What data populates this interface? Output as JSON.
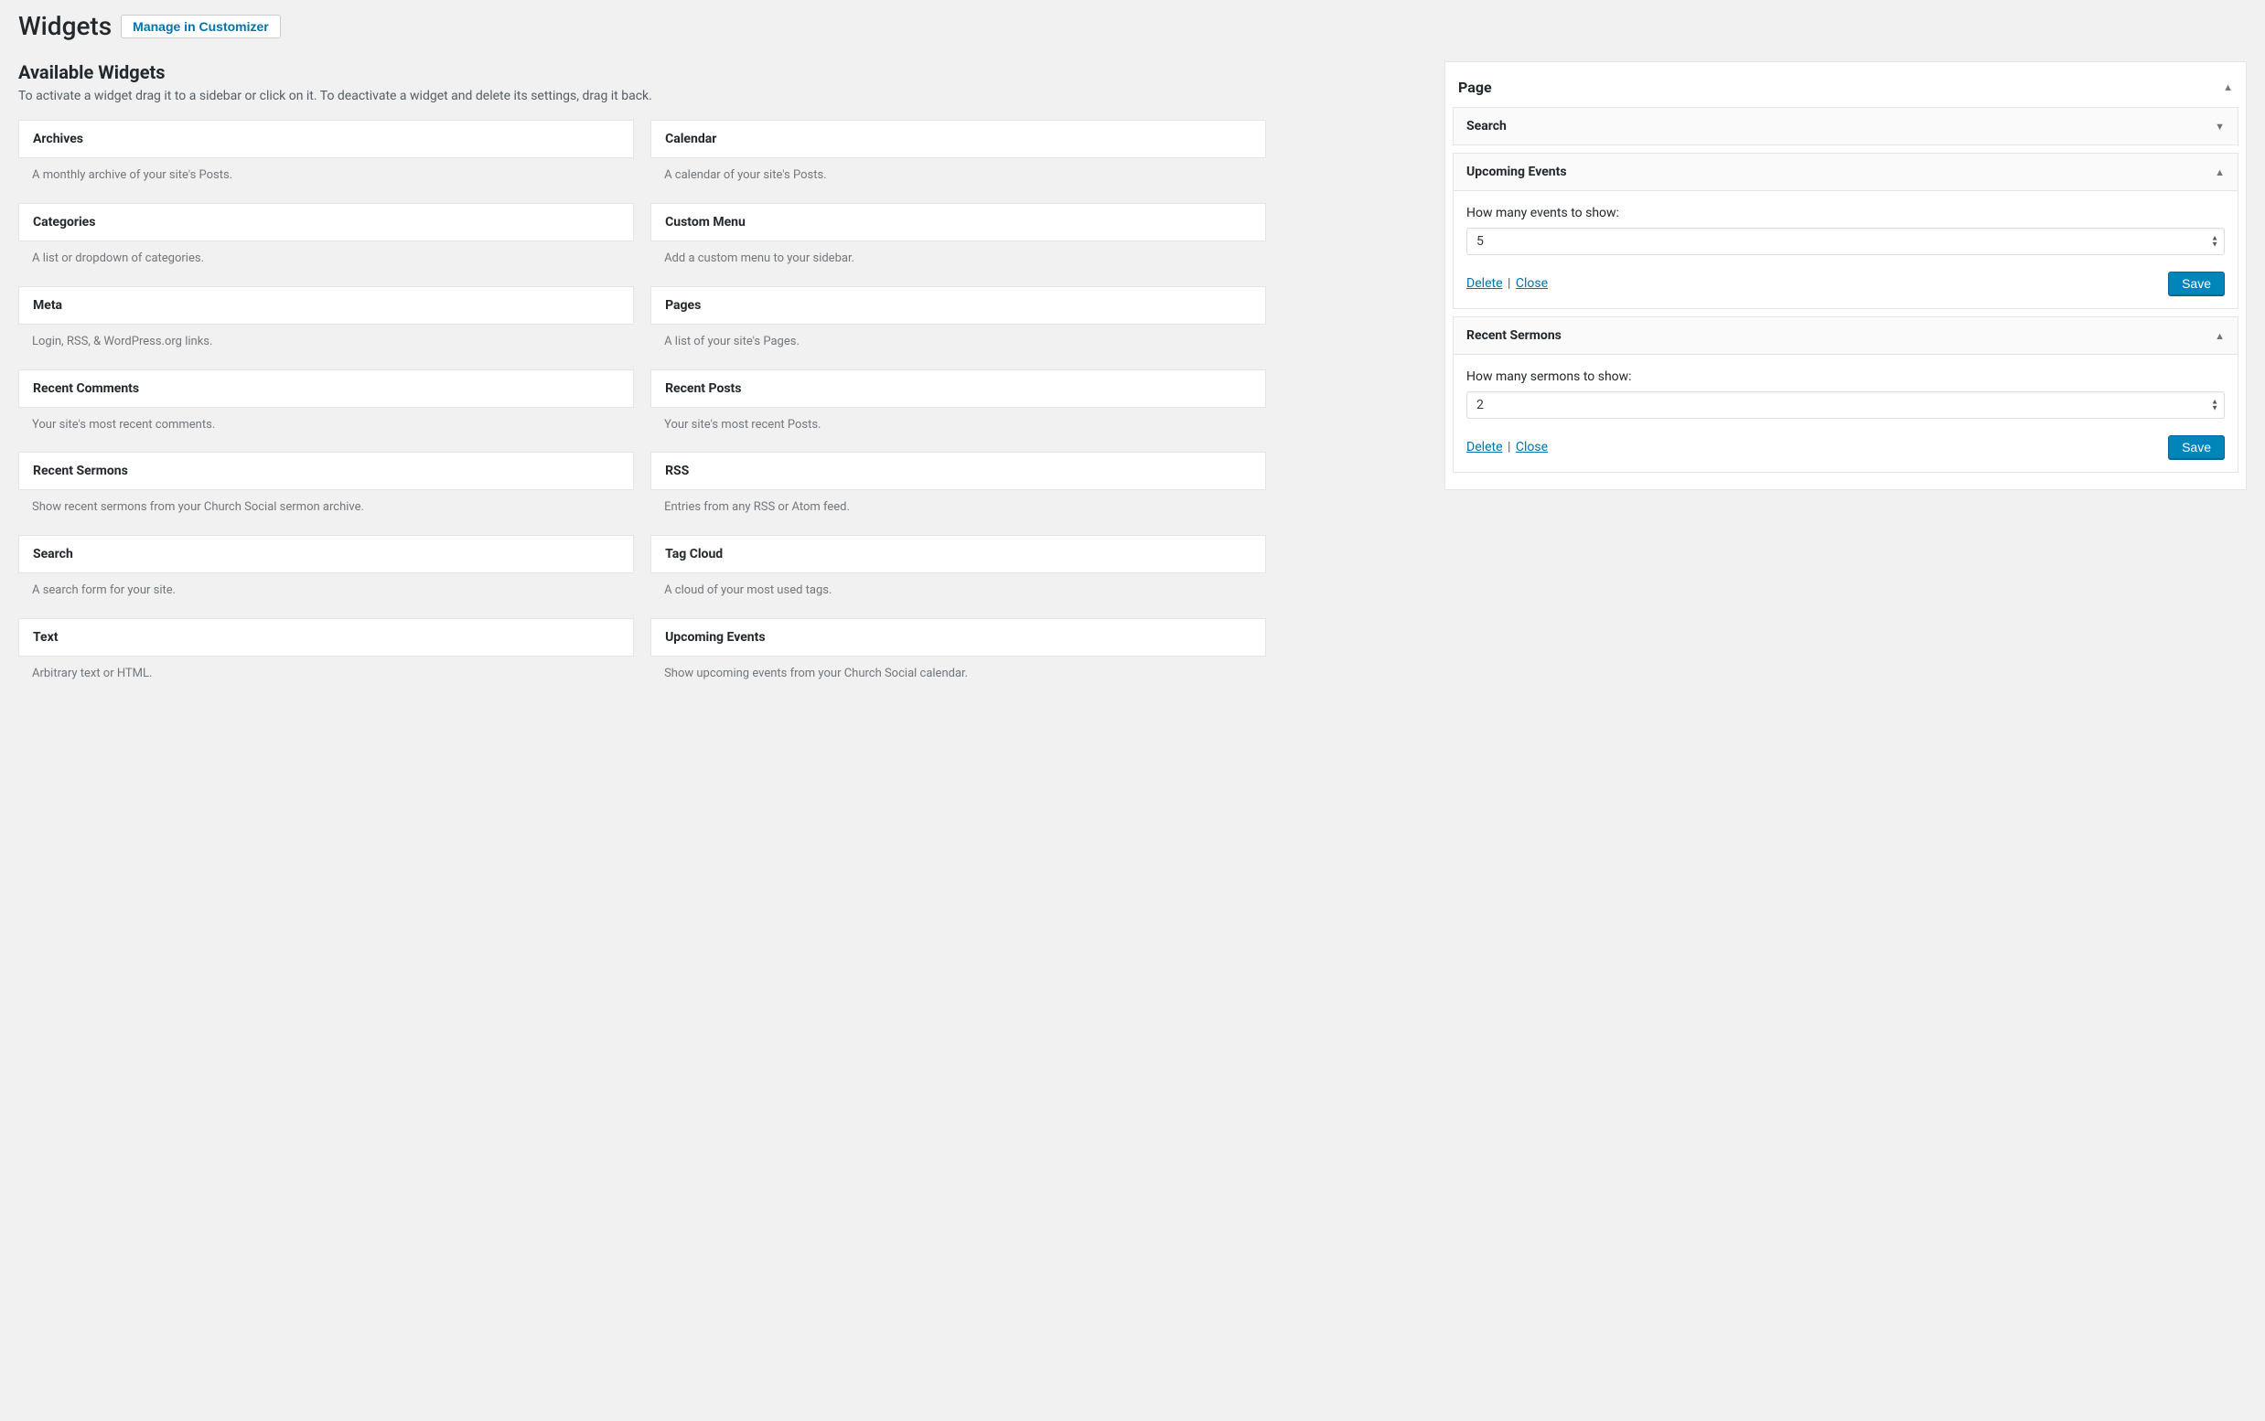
{
  "header": {
    "title": "Widgets",
    "customizer_button": "Manage in Customizer"
  },
  "available": {
    "title": "Available Widgets",
    "description": "To activate a widget drag it to a sidebar or click on it. To deactivate a widget and delete its settings, drag it back.",
    "items": [
      {
        "title": "Archives",
        "desc": "A monthly archive of your site's Posts."
      },
      {
        "title": "Calendar",
        "desc": "A calendar of your site's Posts."
      },
      {
        "title": "Categories",
        "desc": "A list or dropdown of categories."
      },
      {
        "title": "Custom Menu",
        "desc": "Add a custom menu to your sidebar."
      },
      {
        "title": "Meta",
        "desc": "Login, RSS, & WordPress.org links."
      },
      {
        "title": "Pages",
        "desc": "A list of your site's Pages."
      },
      {
        "title": "Recent Comments",
        "desc": "Your site's most recent comments."
      },
      {
        "title": "Recent Posts",
        "desc": "Your site's most recent Posts."
      },
      {
        "title": "Recent Sermons",
        "desc": "Show recent sermons from your Church Social sermon archive."
      },
      {
        "title": "RSS",
        "desc": "Entries from any RSS or Atom feed."
      },
      {
        "title": "Search",
        "desc": "A search form for your site."
      },
      {
        "title": "Tag Cloud",
        "desc": "A cloud of your most used tags."
      },
      {
        "title": "Text",
        "desc": "Arbitrary text or HTML."
      },
      {
        "title": "Upcoming Events",
        "desc": "Show upcoming events from your Church Social calendar."
      }
    ]
  },
  "sidebar_area": {
    "title": "Page",
    "items": [
      {
        "title": "Search",
        "expanded": false
      },
      {
        "title": "Upcoming Events",
        "expanded": true,
        "label": "How many events to show:",
        "value": "5",
        "delete": "Delete",
        "close": "Close",
        "save": "Save"
      },
      {
        "title": "Recent Sermons",
        "expanded": true,
        "label": "How many sermons to show:",
        "value": "2",
        "delete": "Delete",
        "close": "Close",
        "save": "Save"
      }
    ]
  }
}
